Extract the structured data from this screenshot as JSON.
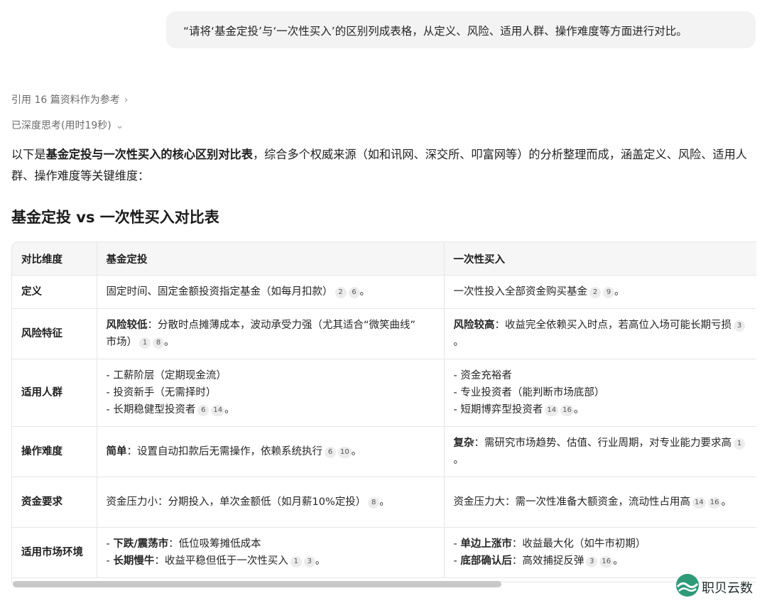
{
  "user_message": "“请将‘基金定投’与‘一次性买入’的区别列成表格，从定义、风险、适用人群、操作难度等方面进行对比。",
  "references": {
    "label": "引用 16 篇资料作为参考",
    "chevron": "chevron-right-icon"
  },
  "thinking": {
    "label": "已深度思考(用时19秒)",
    "chevron": "chevron-down-icon"
  },
  "intro": {
    "prefix": "以下是",
    "bold": "基金定投与一次性买入的核心区别对比表",
    "suffix": "，综合多个权威来源（如和讯网、深交所、叩富网等）的分析整理而成，涵盖定义、风险、适用人群、操作难度等关键维度："
  },
  "heading": "基金定投 vs 一次性买入对比表",
  "table": {
    "headers": [
      "对比维度",
      "基金定投",
      "一次性买入"
    ],
    "rows": [
      {
        "dim": "定义",
        "a": [
          {
            "bold": "",
            "text": "固定时间、固定金额投资指定基金（如每月扣款）",
            "cites": [
              "2",
              "6"
            ],
            "end": "。"
          }
        ],
        "b": [
          {
            "bold": "",
            "text": "一次性投入全部资金购买基金",
            "cites": [
              "2",
              "9"
            ],
            "end": "。"
          }
        ]
      },
      {
        "dim": "风险特征",
        "a": [
          {
            "bold": "风险较低",
            "text": "：分散时点摊薄成本，波动承受力强（尤其适合“微笑曲线”",
            "cites": [],
            "end": ""
          },
          {
            "bold": "",
            "text": "市场）",
            "cites": [
              "1",
              "8"
            ],
            "end": "。"
          }
        ],
        "b": [
          {
            "bold": "风险较高",
            "text": "：收益完全依赖买入时点，若高位入场可能长期亏损",
            "cites": [
              "3"
            ],
            "end": ""
          },
          {
            "bold": "",
            "text": "。",
            "cites": [],
            "end": ""
          }
        ]
      },
      {
        "dim": "适用人群",
        "a": [
          {
            "bold": "",
            "text": "- 工薪阶层（定期现金流）",
            "cites": [],
            "end": ""
          },
          {
            "bold": "",
            "text": "- 投资新手（无需择时）",
            "cites": [],
            "end": ""
          },
          {
            "bold": "",
            "text": "- 长期稳健型投资者",
            "cites": [
              "6",
              "14"
            ],
            "end": "。"
          }
        ],
        "b": [
          {
            "bold": "",
            "text": "- 资金充裕者",
            "cites": [],
            "end": ""
          },
          {
            "bold": "",
            "text": "- 专业投资者（能判断市场底部）",
            "cites": [],
            "end": ""
          },
          {
            "bold": "",
            "text": "- 短期博弈型投资者",
            "cites": [
              "14",
              "16"
            ],
            "end": "。"
          }
        ]
      },
      {
        "dim": "操作难度",
        "a": [
          {
            "bold": "简单",
            "text": "：设置自动扣款后无需操作，依赖系统执行",
            "cites": [
              "6",
              "10"
            ],
            "end": "。"
          }
        ],
        "b": [
          {
            "bold": "复杂",
            "text": "：需研究市场趋势、估值、行业周期，对专业能力要求高",
            "cites": [
              "1"
            ],
            "end": ""
          },
          {
            "bold": "",
            "text": "。",
            "cites": [],
            "end": ""
          }
        ]
      },
      {
        "dim": "资金要求",
        "a": [
          {
            "bold": "",
            "text": "资金压力小：分期投入，单次金额低（如月薪10%定投）",
            "cites": [
              "8"
            ],
            "end": "。"
          }
        ],
        "b": [
          {
            "bold": "",
            "text": "资金压力大：需一次性准备大额资金，流动性占用高",
            "cites": [
              "14",
              "16"
            ],
            "end": "。"
          }
        ]
      },
      {
        "dim": "适用市场环境",
        "a": [
          {
            "lead": "- ",
            "bold": "下跌/震荡市",
            "text": "：低位吸筹摊低成本",
            "cites": [],
            "end": ""
          },
          {
            "lead": "- ",
            "bold": "长期慢牛",
            "text": "：收益平稳但低于一次性买入",
            "cites": [
              "1",
              "3"
            ],
            "end": "。"
          }
        ],
        "b": [
          {
            "lead": "- ",
            "bold": "单边上涨市",
            "text": "：收益最大化（如牛市初期）",
            "cites": [],
            "end": ""
          },
          {
            "lead": "- ",
            "bold": "底部确认后",
            "text": "：高效捕捉反弹",
            "cites": [
              "3",
              "16"
            ],
            "end": "。"
          }
        ]
      }
    ]
  },
  "watermark": {
    "text": "职贝云数",
    "icon": "wave-logo-icon"
  },
  "colors": {
    "bubble": "#f3f3f3",
    "header_bg": "#f6f6f6",
    "border": "#e6e6e6",
    "logo": "#2f9a78"
  }
}
